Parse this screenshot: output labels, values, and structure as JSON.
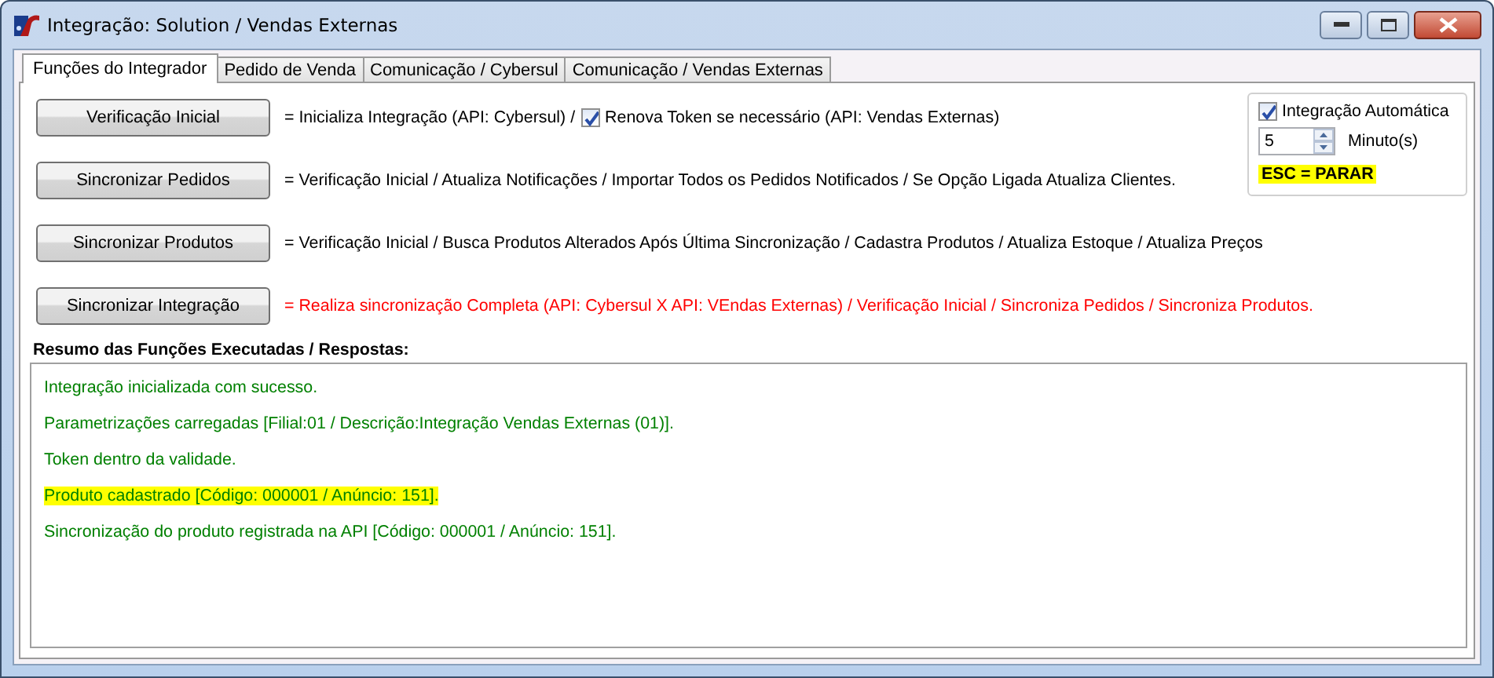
{
  "window": {
    "title": "Integração: Solution / Vendas Externas"
  },
  "tabs": [
    {
      "label": "Funções do Integrador",
      "selected": true
    },
    {
      "label": "Pedido de Venda",
      "selected": false
    },
    {
      "label": "Comunicação / Cybersul",
      "selected": false
    },
    {
      "label": "Comunicação / Vendas Externas",
      "selected": false
    }
  ],
  "actions": [
    {
      "button": "Verificação Inicial",
      "description": "= Inicializa Integração (API: Cybersul) /",
      "alert": false,
      "checkbox": {
        "label": "Renova Token se necessário (API: Vendas Externas)",
        "checked": true
      }
    },
    {
      "button": "Sincronizar Pedidos",
      "description": "= Verificação Inicial / Atualiza Notificações / Importar Todos os Pedidos Notificados / Se Opção Ligada Atualiza Clientes.",
      "alert": false
    },
    {
      "button": "Sincronizar Produtos",
      "description": "= Verificação Inicial / Busca Produtos Alterados Após Última Sincronização / Cadastra Produtos / Atualiza Estoque / Atualiza Preços",
      "alert": false
    },
    {
      "button": "Sincronizar Integração",
      "description": "= Realiza sincronização Completa (API: Cybersul X API: VEndas Externas) / Verificação Inicial / Sincroniza Pedidos / Sincroniza Produtos.",
      "alert": true
    }
  ],
  "auto": {
    "label": "Integração Automática",
    "checked": true,
    "interval": "5",
    "unit": "Minuto(s)",
    "hint": "ESC = PARAR"
  },
  "log": {
    "title": "Resumo das Funções Executadas / Respostas:",
    "lines": [
      {
        "text": "Integração inicializada com sucesso.",
        "highlighted": false
      },
      {
        "text": "Parametrizações carregadas [Filial:01 / Descrição:Integração Vendas Externas (01)].",
        "highlighted": false
      },
      {
        "text": "Token dentro da validade.",
        "highlighted": false
      },
      {
        "text": "Produto cadastrado [Código: 000001 / Anúncio: 151].",
        "highlighted": true
      },
      {
        "text": "Sincronização do produto registrada na API [Código: 000001 / Anúncio: 151].",
        "highlighted": false
      }
    ]
  }
}
